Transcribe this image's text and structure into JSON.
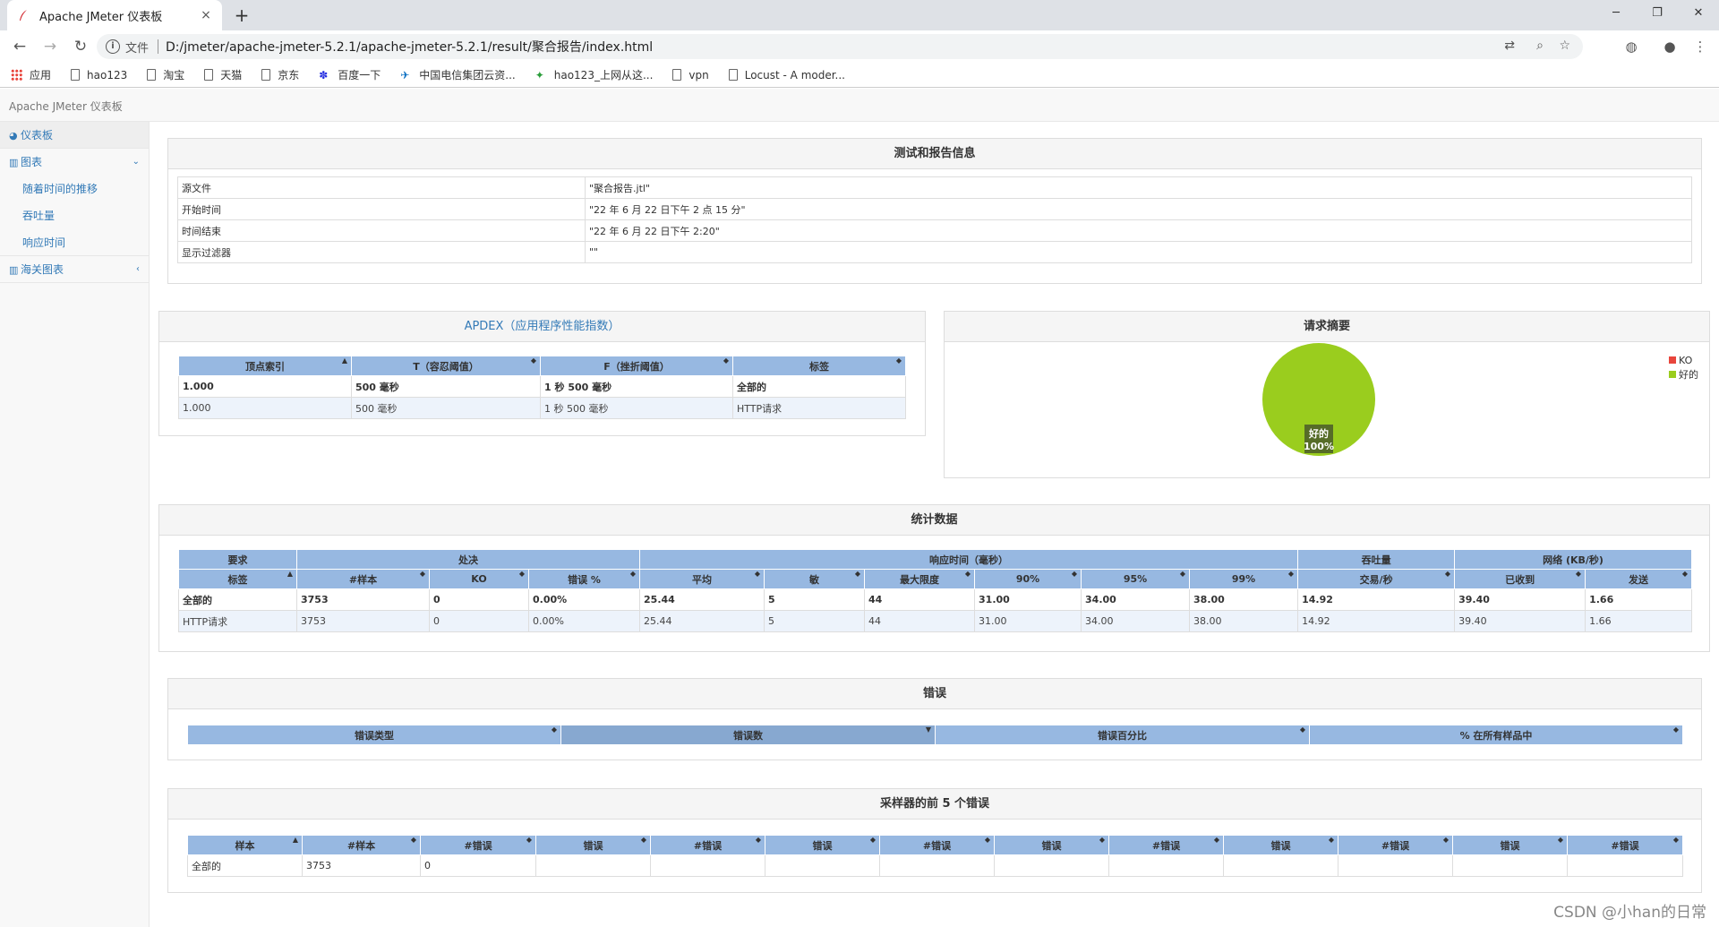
{
  "browser": {
    "tab_title": "Apache JMeter 仪表板",
    "tab_close": "×",
    "new_tab": "+",
    "scheme_label": "文件",
    "url": "D:/jmeter/apache-jmeter-5.2.1/apache-jmeter-5.2.1/result/聚合报告/index.html",
    "bookmarks": [
      "应用",
      "hao123",
      "淘宝",
      "天猫",
      "京东",
      "百度一下",
      "中国电信集团云资...",
      "hao123_上网从这...",
      "vpn",
      "Locust - A moder..."
    ]
  },
  "app": {
    "header_title": "Apache JMeter 仪表板"
  },
  "sidebar": {
    "dashboard": "仪表板",
    "charts": "图表",
    "charts_sub": [
      "随着时间的推移",
      "吞吐量",
      "响应时间"
    ],
    "custom_charts": "海关图表"
  },
  "test_info": {
    "title": "测试和报告信息",
    "rows": [
      {
        "k": "源文件",
        "v": "\"聚合报告.jtl\""
      },
      {
        "k": "开始时间",
        "v": "\"22 年 6 月 22 日下午 2 点 15 分\""
      },
      {
        "k": "时间结束",
        "v": "\"22 年 6 月 22 日下午 2:20\""
      },
      {
        "k": "显示过滤器",
        "v": "\"\""
      }
    ]
  },
  "apdex": {
    "title": "APDEX（应用程序性能指数）",
    "headers": [
      "顶点索引",
      "T（容忍阈值）",
      "F（挫折阈值）",
      "标签"
    ],
    "rows": [
      [
        "1.000",
        "500 毫秒",
        "1 秒 500 毫秒",
        "全部的"
      ],
      [
        "1.000",
        "500 毫秒",
        "1 秒 500 毫秒",
        "HTTP请求"
      ]
    ]
  },
  "request_summary": {
    "title": "请求摘要",
    "legend": [
      "KO",
      "好的"
    ],
    "slice_label": "好的",
    "slice_pct": "100%",
    "colors": {
      "ko": "#e8453c",
      "ok": "#9acd1e"
    }
  },
  "chart_data": {
    "type": "pie",
    "categories": [
      "KO",
      "好的"
    ],
    "values": [
      0,
      100
    ],
    "legend": "top-right"
  },
  "stats": {
    "title": "统计数据",
    "group_headers": [
      "要求",
      "处决",
      "响应时间（毫秒）",
      "吞吐量",
      "网络 (KB/秒)"
    ],
    "headers": [
      "标签",
      "#样本",
      "KO",
      "错误 %",
      "平均",
      "敏",
      "最大限度",
      "90%",
      "95%",
      "99%",
      "交易/秒",
      "已收到",
      "发送"
    ],
    "rows": [
      [
        "全部的",
        "3753",
        "0",
        "0.00%",
        "25.44",
        "5",
        "44",
        "31.00",
        "34.00",
        "38.00",
        "14.92",
        "39.40",
        "1.66"
      ],
      [
        "HTTP请求",
        "3753",
        "0",
        "0.00%",
        "25.44",
        "5",
        "44",
        "31.00",
        "34.00",
        "38.00",
        "14.92",
        "39.40",
        "1.66"
      ]
    ]
  },
  "errors": {
    "title": "错误",
    "headers": [
      "错误类型",
      "错误数",
      "错误百分比",
      "% 在所有样品中"
    ]
  },
  "top5": {
    "title": "采样器的前 5 个错误",
    "headers": [
      "样本",
      "#样本",
      "#错误",
      "错误",
      "#错误",
      "错误",
      "#错误",
      "错误",
      "#错误",
      "错误",
      "#错误",
      "错误",
      "#错误"
    ],
    "rows": [
      [
        "全部的",
        "3753",
        "0",
        "",
        "",
        "",
        "",
        "",
        "",
        "",
        "",
        "",
        ""
      ]
    ]
  },
  "watermark": "CSDN @小han的日常"
}
